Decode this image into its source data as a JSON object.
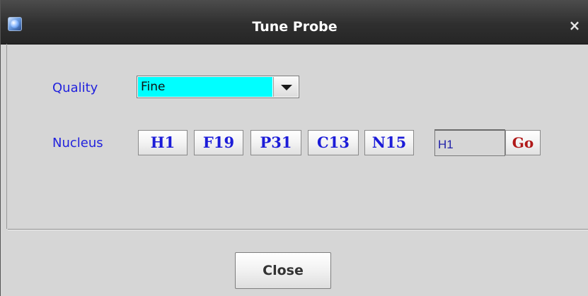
{
  "window": {
    "title": "Tune Probe",
    "app_icon": "app-icon",
    "close_glyph": "×"
  },
  "quality": {
    "label": "Quality",
    "selected": "Fine",
    "highlight_color": "#00ffff"
  },
  "nucleus": {
    "label": "Nucleus",
    "buttons": [
      "H1",
      "F19",
      "P31",
      "C13",
      "N15"
    ],
    "input_value": "H1",
    "go_label": "Go"
  },
  "footer": {
    "close_label": "Close"
  },
  "colors": {
    "label_blue": "#2222dd",
    "button_text_blue": "#1c1cd8",
    "go_text_red": "#b01818",
    "titlebar_dark": "#2f2f2f"
  }
}
